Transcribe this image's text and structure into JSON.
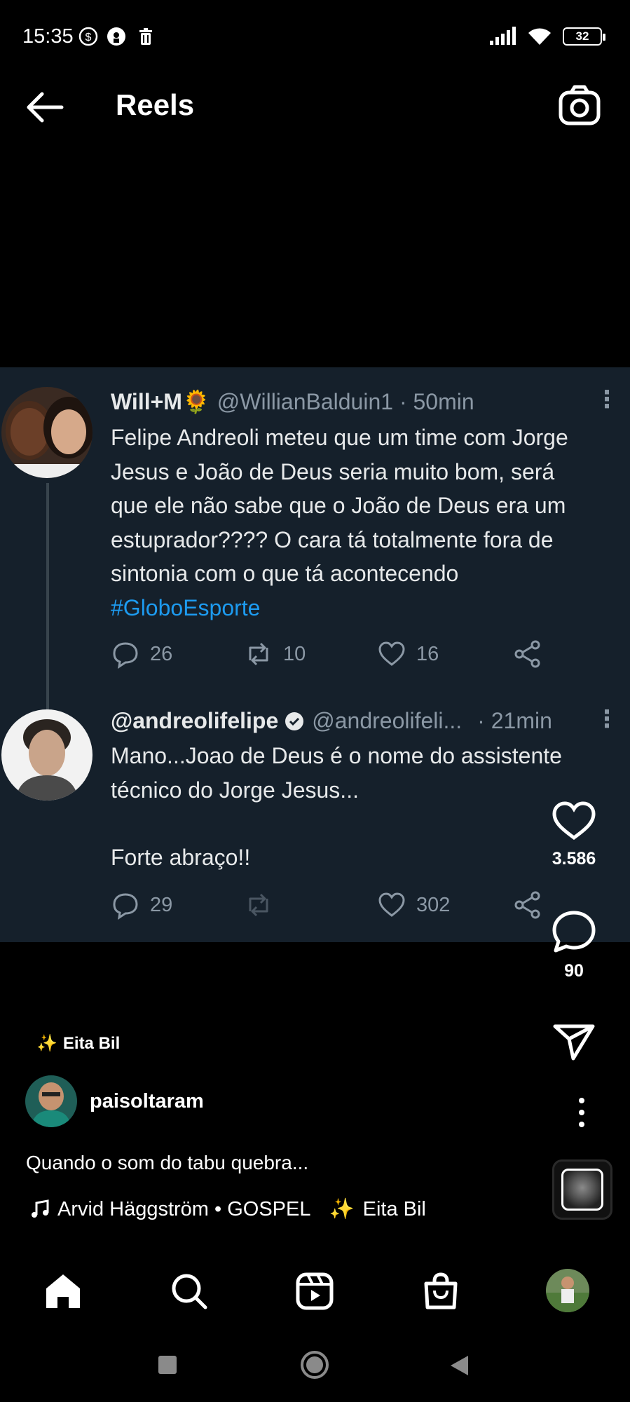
{
  "status_bar": {
    "time": "15:35",
    "battery": "32",
    "icons": [
      "dollar-circle-icon",
      "eye-icon",
      "trash-icon",
      "signal-icon",
      "wifi-icon",
      "battery-icon"
    ]
  },
  "header": {
    "title": "Reels",
    "back_icon": "arrow-left-icon",
    "camera_icon": "camera-icon"
  },
  "tweets": [
    {
      "name": "Will+M🌻",
      "handle_time": "@WillianBalduin1 · 50min",
      "body_lines": [
        "Felipe Andreoli meteu que um time com Jorge",
        "Jesus e João de Deus seria muito bom, será",
        "que ele não sabe que o João de Deus era um",
        "estuprador???? O cara tá totalmente fora de",
        "sintonia com o que tá acontecendo"
      ],
      "hashtag": "#GloboEsporte",
      "replies": "26",
      "retweets": "10",
      "likes": "16"
    },
    {
      "name": "@andreolifelipe",
      "handle": "@andreolifeli...",
      "time": "· 21min",
      "body_lines": [
        "Mano...Joao de Deus é o nome do assistente",
        "técnico do Jorge Jesus...",
        "",
        "Forte abraço!!"
      ],
      "replies": "29",
      "retweets": "",
      "likes": "302"
    }
  ],
  "rail": {
    "likes": "3.586",
    "comments": "90"
  },
  "reel": {
    "effect": "Eita Bil",
    "author": "paisoltaram",
    "caption": "Quando o som do tabu quebra...",
    "audio": "Arvid Häggström • GOSPEL",
    "audio_effect": "Eita Bil"
  },
  "nav": [
    "home-icon",
    "search-icon",
    "reels-icon",
    "shop-icon",
    "profile-avatar"
  ],
  "colors": {
    "background": "#000000",
    "tweet_card": "#15202b",
    "tweet_text": "#e7e9ea",
    "tweet_meta": "#8b98a5",
    "hashtag": "#1d9bf0"
  }
}
